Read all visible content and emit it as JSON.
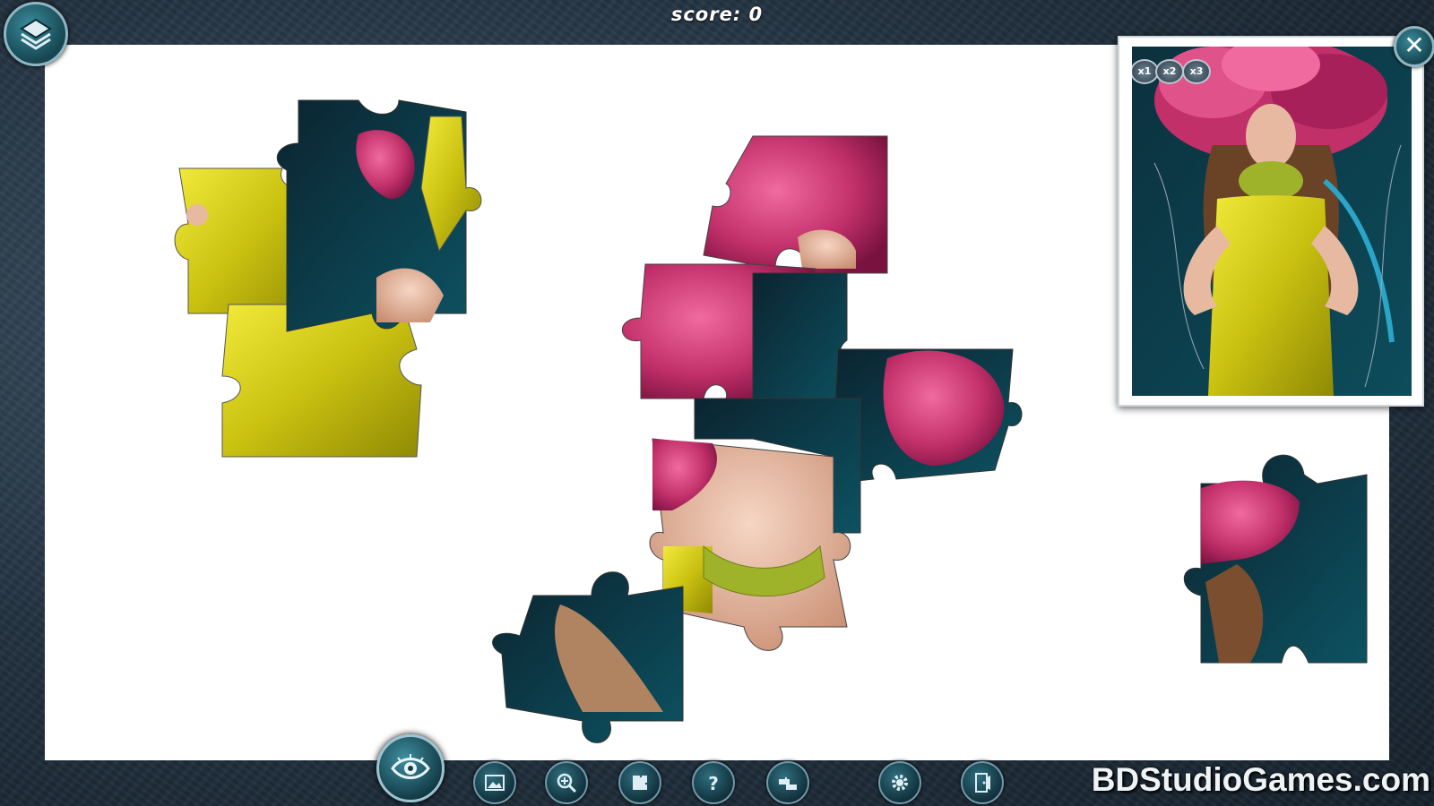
{
  "hud": {
    "score_text": "score: 0",
    "score_value": 0,
    "menu_icon": "layers-icon",
    "close_icon": "close-icon",
    "close_label": "✕"
  },
  "preview": {
    "multipliers": [
      "x1",
      "x2",
      "x3"
    ]
  },
  "toolbar": {
    "buttons": [
      {
        "name": "eye-icon",
        "purpose": "show-preview"
      },
      {
        "name": "picture-icon",
        "purpose": "background"
      },
      {
        "name": "zoom-icon",
        "purpose": "magnify"
      },
      {
        "name": "edge-pieces-icon",
        "purpose": "sort-edges"
      },
      {
        "name": "help-icon",
        "purpose": "hint"
      },
      {
        "name": "shuffle-pieces-icon",
        "purpose": "scatter"
      },
      {
        "name": "settings-icon",
        "purpose": "options"
      },
      {
        "name": "exit-icon",
        "purpose": "exit"
      }
    ]
  },
  "watermark": "BDStudioGames.com",
  "colors": {
    "frame": "#22313f",
    "board": "#ffffff",
    "dress_yellow": "#d8d017",
    "flower_pink": "#c2306a",
    "backdrop_teal": "#0d5261",
    "dark_navy": "#0b2430",
    "skin": "#e7b9a1",
    "button_teal": "#2f6f80"
  }
}
